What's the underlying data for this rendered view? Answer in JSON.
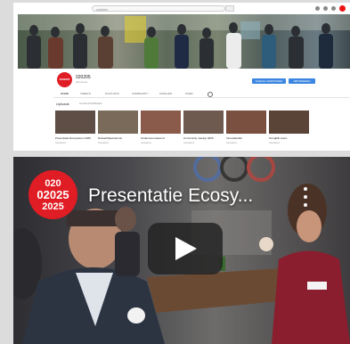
{
  "browser": {
    "search_placeholder": "zoeken",
    "channel_logo_text": "0202025",
    "channel_name": "020205",
    "channel_subs": "abonnees",
    "subscribe_label": "ABONNEREN",
    "customize_label": "KANAAL AANPASSEN",
    "tabs": [
      "HOME",
      "VIDEO'S",
      "PLAYLISTS",
      "COMMUNITY",
      "KANALEN",
      "OVER"
    ],
    "shelf_title": "Uploads",
    "shelf_play_all": "ALLES AFSPELEN",
    "thumbnails": [
      {
        "title": "Presentatie Ecosysteem 2025",
        "meta": "weergaven"
      },
      {
        "title": "Netwerkbijeenkomst",
        "meta": "weergaven"
      },
      {
        "title": "Ondernemersavond",
        "meta": "weergaven"
      },
      {
        "title": "Community meetup 2025",
        "meta": "weergaven"
      },
      {
        "title": "Innovatiecafé",
        "meta": "weergaven"
      },
      {
        "title": "Terugblik event",
        "meta": "weergaven"
      }
    ]
  },
  "player": {
    "title": "Presentatie Ecosy...",
    "badge_line1": "020",
    "badge_line2": "02025",
    "badge_line3": "2025"
  },
  "colors": {
    "brand_red": "#e01c24",
    "button_blue": "#3b86e0"
  }
}
